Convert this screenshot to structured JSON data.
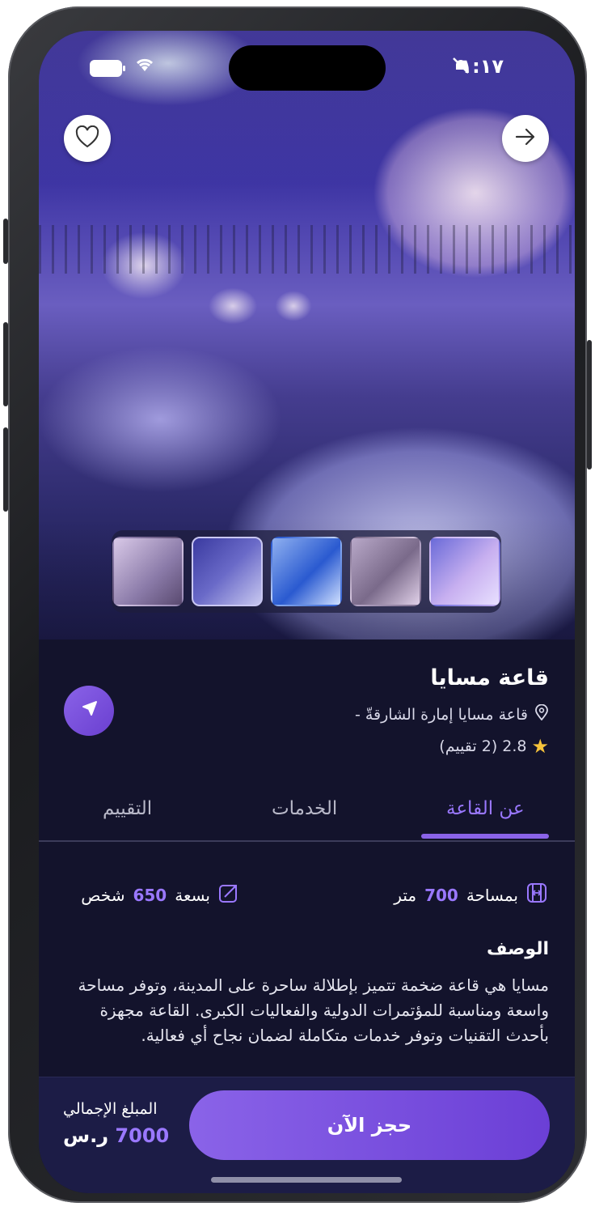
{
  "status_bar": {
    "time": "١:١٧"
  },
  "gallery": {
    "thumbnails": [
      "thumb-1",
      "thumb-2",
      "thumb-3",
      "thumb-4",
      "thumb-5"
    ],
    "selected_index": 3
  },
  "venue": {
    "name": "قاعة مسايا",
    "location": "قاعة مسايا إمارة الشارقةّ -",
    "rating": "2.8",
    "reviews": "(2 تقييم)"
  },
  "tabs": [
    {
      "label": "عن القاعة",
      "active": true
    },
    {
      "label": "الخدمات",
      "active": false
    },
    {
      "label": "التقييم",
      "active": false
    }
  ],
  "specs": {
    "area_prefix": "بمساحة",
    "area_value": "700",
    "area_unit": "متر",
    "capacity_prefix": "بسعة",
    "capacity_value": "650",
    "capacity_unit": "شخص"
  },
  "description": {
    "title": "الوصف",
    "text": "مسايا هي قاعة ضخمة تتميز بإطلالة ساحرة على المدينة، وتوفر مساحة واسعة ومناسبة للمؤتمرات الدولية والفعاليات الكبرى. القاعة مجهزة بأحدث التقنيات وتوفر خدمات متكاملة لضمان نجاح أي فعالية."
  },
  "footer": {
    "total_label": "المبلغ الإجمالي",
    "total_value": "7000",
    "currency": "ر.س",
    "book_label": "حجز الآن"
  },
  "colors": {
    "accent": "#8a63e8",
    "background": "#13132c",
    "star": "#f6c33b"
  },
  "icons": [
    "heart-icon",
    "arrow-right-icon",
    "location-pin-icon",
    "star-icon",
    "navigate-icon",
    "area-icon",
    "capacity-icon"
  ]
}
